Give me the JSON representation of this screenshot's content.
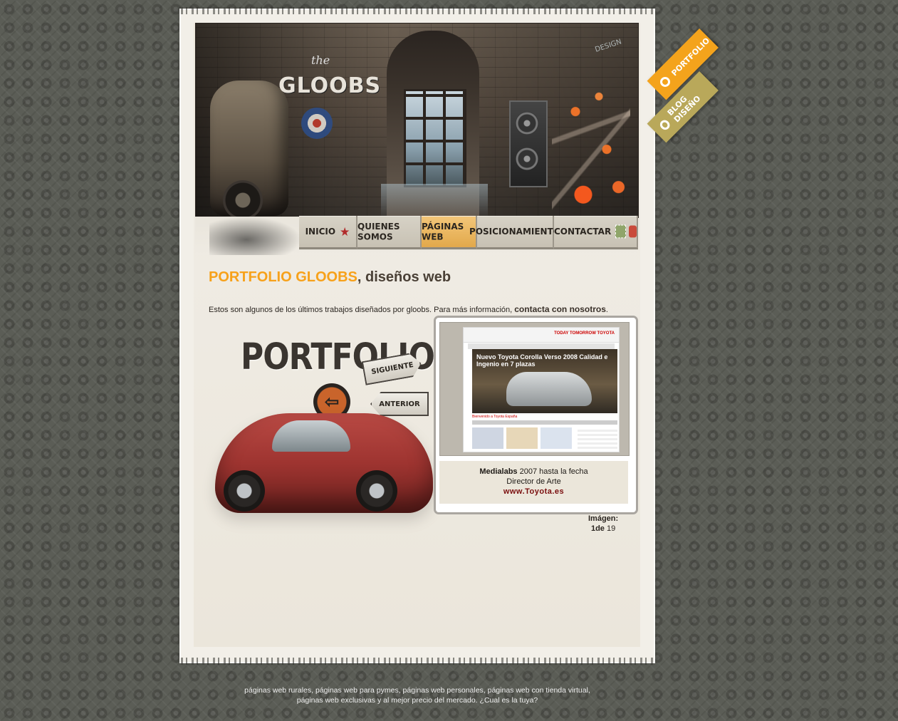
{
  "side_tabs": {
    "portfolio": "Portfolio",
    "blog": "Blog Diseño"
  },
  "banner": {
    "logo_small": "the",
    "logo": "GLOOBS",
    "design_tag": "DESIGN"
  },
  "nav": {
    "items": [
      {
        "label": "Inicio",
        "icon": "star-icon"
      },
      {
        "label": "Quienes somos"
      },
      {
        "label": "Páginas web"
      },
      {
        "label": "Posicionamiento"
      },
      {
        "label": "Contactar",
        "icon": "stamp-icon"
      }
    ],
    "active_index": 2
  },
  "content": {
    "title_highlight": "PORTFOLIO GLOOBS",
    "title_rest": ", diseños web",
    "intro_text": "Estos son algunos de los últimos trabajos diseñados por gloobs. Para más información, ",
    "intro_link": "contacta con nosotros",
    "intro_end": "."
  },
  "portfolio_art": {
    "word": "PORTFOLIO",
    "next_label": "SIGUIENTE",
    "prev_label": "ANTERIOR"
  },
  "project": {
    "mock_brand": "TODAY TOMORROW TOYOTA",
    "mock_title": "Nuevo Toyota Corolla Verso 2008 Calidad e Ingenio en 7 plazas",
    "mock_welcome": "Bienvenido a Toyota España",
    "company": "Medialabs",
    "period": " 2007 hasta la fecha",
    "role": "Director de Arte",
    "url": "www.Toyota.es"
  },
  "counter": {
    "label": "Imágen:",
    "current": "1",
    "sep": "de",
    "total": "19"
  },
  "footer": {
    "line1": "páginas web rurales, páginas web para pymes, páginas web personales, páginas web con tienda virtual,",
    "line2": "páginas web exclusivas y al mejor precio del mercado. ¿Cual es la tuya?"
  },
  "colors": {
    "accent": "#f7a11a",
    "background": "#5b5d56",
    "paper": "#f2efe8",
    "link_dark": "#7a0e0e"
  }
}
